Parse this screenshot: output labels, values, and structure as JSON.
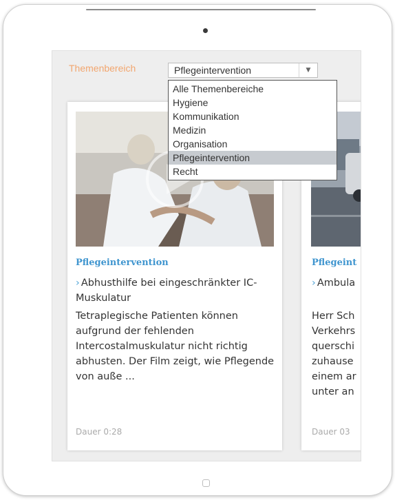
{
  "filter": {
    "label": "Themenbereich",
    "selected_value": "Pflegeintervention",
    "arrow_icon": "chevron-down-icon",
    "options": [
      "Alle Themenbereiche",
      "Hygiene",
      "Kommunikation",
      "Medizin",
      "Organisation",
      "Pflegeintervention",
      "Recht"
    ],
    "highlighted_option_index": 5
  },
  "cards": [
    {
      "category": "Pflegeintervention",
      "title_prefix": "›",
      "title": "Abhusthilfe bei eingeschränkter IC-Muskulatur",
      "description": "Tetraplegische Patienten können aufgrund der fehlenden Intercostalmuskulatur nicht richtig abhusten. Der Film zeigt, wie Pflegende von auße ...",
      "duration": "Dauer 0:28",
      "thumbnail": "nursing-video-thumbnail",
      "play_icon": "play-icon"
    },
    {
      "category": "Pflegeint",
      "title_prefix": "›",
      "title": "Ambula",
      "description_lines": [
        "Herr Sch",
        "Verkehrs",
        "querschi",
        "zuhause",
        "einem ar",
        "unter an"
      ],
      "duration": "Dauer 03",
      "thumbnail": "street-video-thumbnail"
    }
  ],
  "colors": {
    "label_orange": "#f2a66f",
    "category_blue": "#3f95cf",
    "highlight_gray": "#c7cbd0",
    "screen_background": "#eeeeee"
  }
}
